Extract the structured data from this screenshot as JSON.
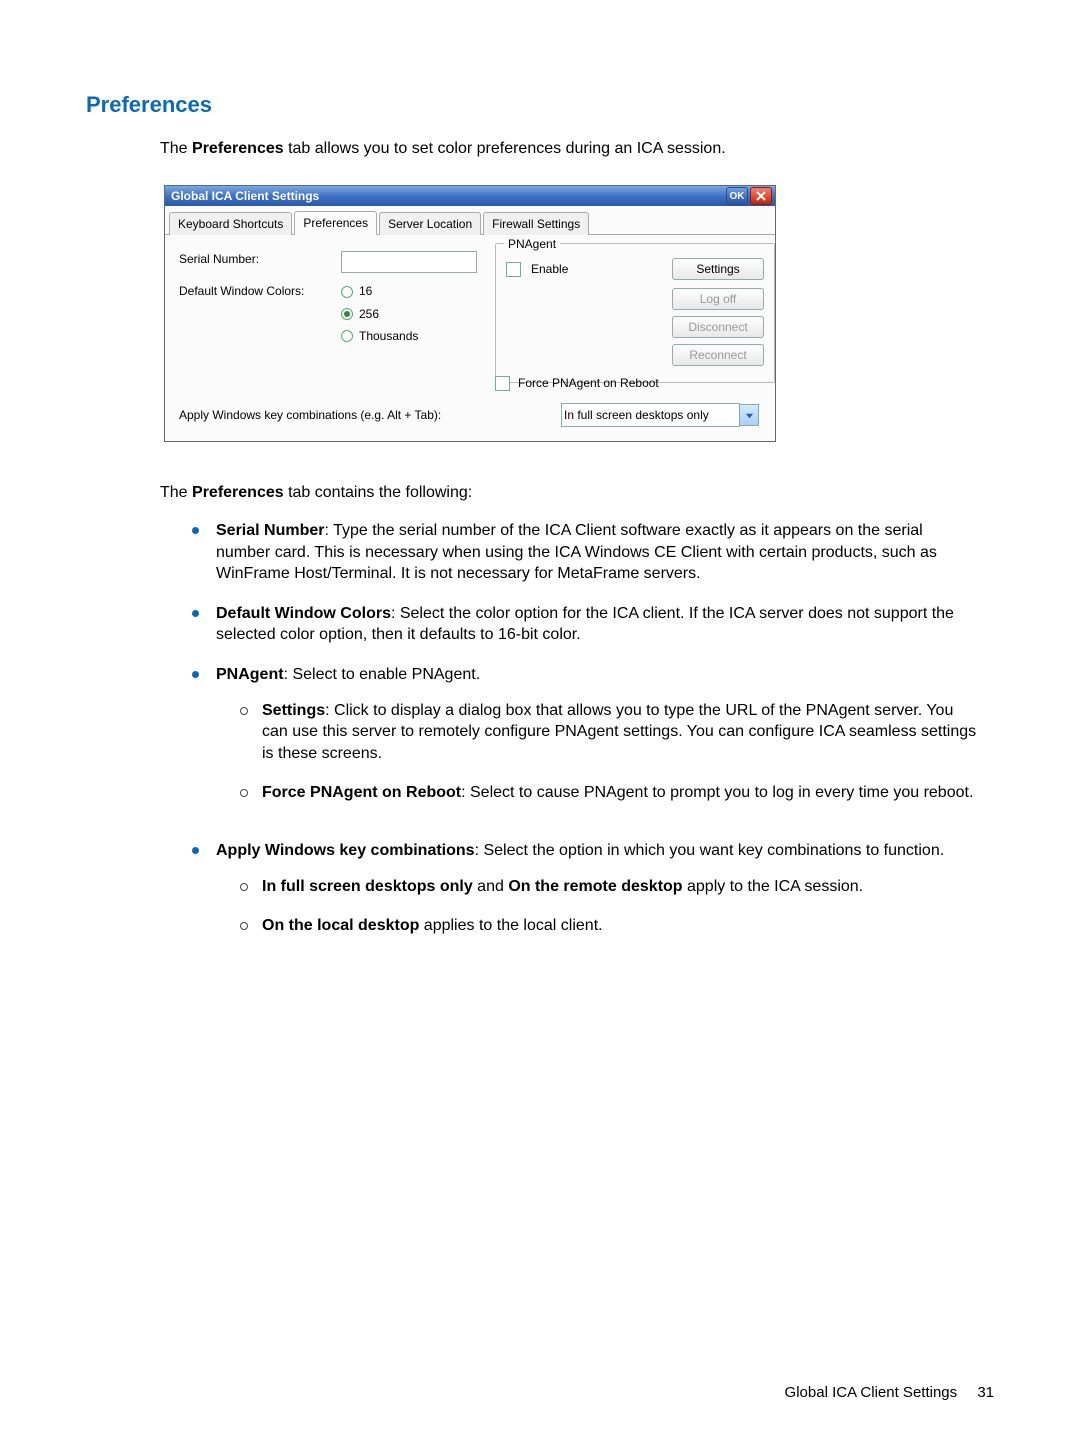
{
  "section_title": "Preferences",
  "intro": {
    "pre": "The ",
    "bold": "Preferences",
    "post": " tab allows you to set color preferences during an ICA session."
  },
  "dialog": {
    "title": "Global ICA Client Settings",
    "ok_label": "OK",
    "tabs": [
      "Keyboard Shortcuts",
      "Preferences",
      "Server Location",
      "Firewall Settings"
    ],
    "active_tab_index": 1,
    "serial_label": "Serial Number:",
    "serial_value": "",
    "colors_label": "Default Window Colors:",
    "color_options": [
      "16",
      "256",
      "Thousands"
    ],
    "color_selected_index": 1,
    "pnagent": {
      "group_title": "PNAgent",
      "enable_label": "Enable",
      "settings_btn": "Settings",
      "logoff_btn": "Log off",
      "disconnect_btn": "Disconnect",
      "reconnect_btn": "Reconnect",
      "force_label": "Force PNAgent on Reboot"
    },
    "apply_label": "Apply Windows key combinations (e.g. Alt + Tab):",
    "apply_value": "In full screen desktops only"
  },
  "body_intro": {
    "pre": "The ",
    "bold": "Preferences",
    "post": " tab contains the following:"
  },
  "items": [
    {
      "term": "Serial Number",
      "text": ": Type the serial number of the ICA Client software exactly as it appears on the serial number card. This is necessary when using the ICA Windows CE Client with certain products, such as WinFrame Host/Terminal. It is not necessary for MetaFrame servers."
    },
    {
      "term": "Default Window Colors",
      "text": ": Select the color option for the ICA client. If the ICA server does not support the selected color option, then it defaults to 16-bit color."
    },
    {
      "term": "PNAgent",
      "text": ": Select to enable PNAgent.",
      "sub": [
        {
          "term": "Settings",
          "text": ": Click to display a dialog box that allows you to type the URL of the PNAgent server. You can use this server to remotely configure PNAgent settings. You can configure ICA seamless settings is these screens."
        },
        {
          "term": "Force PNAgent on Reboot",
          "text": ": Select to cause PNAgent to prompt you to log in every time you reboot."
        }
      ]
    },
    {
      "term": "Apply Windows key combinations",
      "text": ": Select the option in which you want key combinations to function.",
      "sub": [
        {
          "line_bold1": "In full screen desktops only",
          "mid": " and ",
          "line_bold2": "On the remote desktop",
          "text": " apply to the ICA session."
        },
        {
          "line_bold1": "On the local desktop",
          "text": " applies to the local client."
        }
      ]
    }
  ],
  "footer": {
    "label": "Global ICA Client Settings",
    "page": "31"
  }
}
